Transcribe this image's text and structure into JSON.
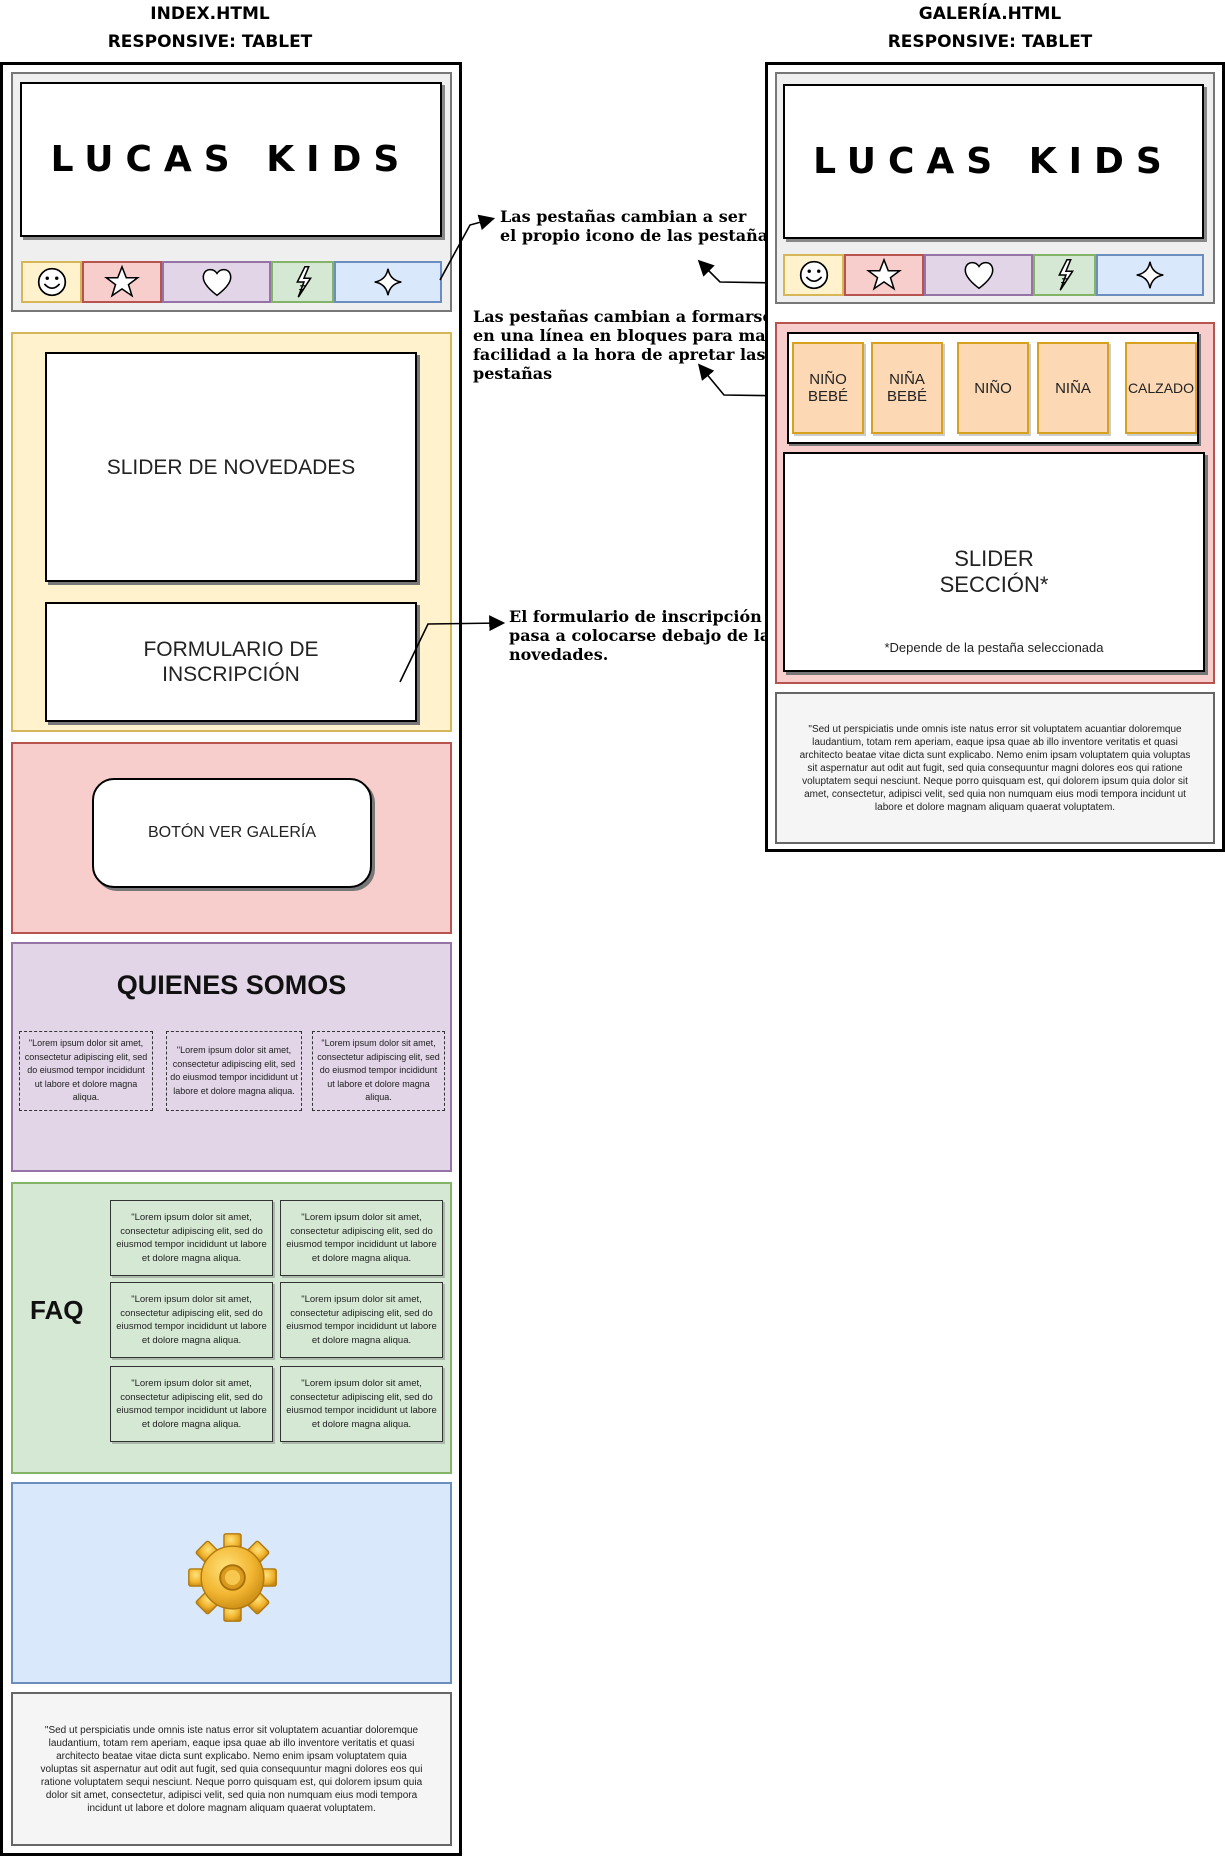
{
  "headings": {
    "index_title": "INDEX.HTML",
    "index_subtitle": "RESPONSIVE: TABLET",
    "gallery_title": "GALERÍA.HTML",
    "gallery_subtitle": "RESPONSIVE: TABLET"
  },
  "logo": "LUCAS KIDS",
  "tabs": [
    {
      "icon": "smiley-icon",
      "color": "#fff2cc",
      "border": "#d6b656"
    },
    {
      "icon": "star-icon",
      "color": "#f8cecc",
      "border": "#b85450"
    },
    {
      "icon": "heart-icon",
      "color": "#e1d5e7",
      "border": "#9673a6"
    },
    {
      "icon": "lightning-icon",
      "color": "#d5e8d4",
      "border": "#82b366"
    },
    {
      "icon": "sparkle-icon",
      "color": "#dae8fc",
      "border": "#6c8ebf"
    }
  ],
  "index": {
    "slider_label": "SLIDER DE NOVEDADES",
    "form_label": "FORMULARIO DE\nINSCRIPCIÓN",
    "gallery_button": "BOTÓN VER GALERÍA",
    "about_title": "QUIENES SOMOS",
    "about_texts": [
      "\"Lorem ipsum dolor sit amet, consectetur adipiscing elit, sed do eiusmod tempor incididunt ut labore et dolore magna aliqua.",
      "\"Lorem ipsum dolor sit amet, consectetur adipiscing elit, sed do eiusmod tempor incididunt ut labore et dolore magna aliqua.",
      "\"Lorem ipsum dolor sit amet, consectetur adipiscing elit, sed do eiusmod tempor incididunt ut labore et dolore magna aliqua."
    ],
    "faq_title": "FAQ",
    "faq_texts": [
      "\"Lorem ipsum dolor sit amet, consectetur adipiscing elit, sed do eiusmod tempor incididunt ut labore et dolore magna aliqua.",
      "\"Lorem ipsum dolor sit amet, consectetur adipiscing elit, sed do eiusmod tempor incididunt ut labore et dolore magna aliqua.",
      "\"Lorem ipsum dolor sit amet, consectetur adipiscing elit, sed do eiusmod tempor incididunt ut labore et dolore magna aliqua.",
      "\"Lorem ipsum dolor sit amet, consectetur adipiscing elit, sed do eiusmod tempor incididunt ut labore et dolore magna aliqua.",
      "\"Lorem ipsum dolor sit amet, consectetur adipiscing elit, sed do eiusmod tempor incididunt ut labore et dolore magna aliqua.",
      "\"Lorem ipsum dolor sit amet, consectetur adipiscing elit, sed do eiusmod tempor incididunt ut labore et dolore magna aliqua."
    ],
    "footer_text": "\"Sed ut perspiciatis unde omnis iste natus error sit voluptatem acuantiar doloremque laudantium, totam rem aperiam, eaque ipsa quae ab illo inventore veritatis et quasi architecto beatae vitae dicta sunt explicabo. Nemo enim ipsam voluptatem quia voluptas sit aspernatur aut odit aut fugit, sed quia consequuntur magni dolores eos qui ratione voluptatem sequi nesciunt. Neque porro quisquam est, qui dolorem ipsum quia dolor sit amet, consectetur, adipisci velit, sed quia non numquam eius modi tempora incidunt ut labore et dolore magnam aliquam quaerat voluptatem."
  },
  "gallery": {
    "categories": [
      "NIÑO\nBEBÉ",
      "NIÑA\nBEBÉ",
      "NIÑO",
      "NIÑA",
      "CALZADO"
    ],
    "slider_label": "SLIDER\nSECCIÓN*",
    "slider_note": "*Depende de la pestaña seleccionada",
    "footer_text": "\"Sed ut perspiciatis unde omnis iste natus error sit voluptatem acuantiar doloremque laudantium, totam rem aperiam, eaque ipsa quae ab illo inventore veritatis et quasi architecto beatae vitae dicta sunt explicabo. Nemo enim ipsam voluptatem quia voluptas sit aspernatur aut odit aut fugit, sed quia consequuntur magni dolores eos qui ratione voluptatem sequi nesciunt. Neque porro quisquam est, qui dolorem ipsum quia dolor sit amet, consectetur, adipisci velit, sed quia non numquam eius modi tempora incidunt ut labore et dolore magnam aliquam quaerat voluptatem."
  },
  "annotations": {
    "tabs_icon": "Las pestañas cambian a ser\nel propio icono de las pestañas.",
    "tabs_blocks": "Las pestañas cambian a formarse\nen una línea en bloques para mayor\nfacilidad a la hora de apretar las\npestañas",
    "form_move": "El formulario de inscripción\npasa a colocarse debajo de las\nnovedades."
  },
  "colors": {
    "yellow": "#fff2cc",
    "yellow_border": "#d6b656",
    "red": "#f8cecc",
    "red_border": "#b85450",
    "purple": "#e1d5e7",
    "purple_border": "#9673a6",
    "green": "#d5e8d4",
    "green_border": "#82b366",
    "blue": "#dae8fc",
    "blue_border": "#6c8ebf",
    "orange": "#fcd9b4",
    "orange_border": "#d6a21e",
    "grey": "#f5f5f5"
  }
}
